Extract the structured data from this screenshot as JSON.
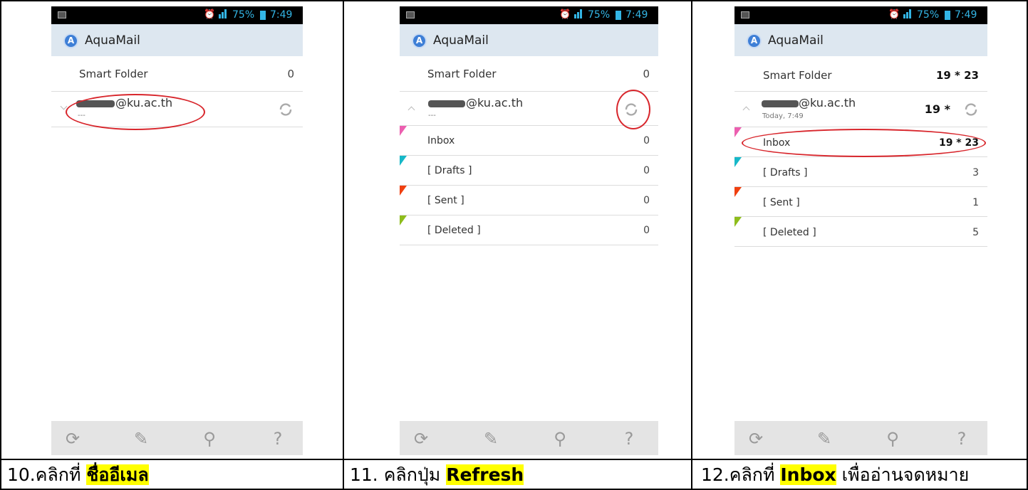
{
  "app": {
    "title": "AquaMail"
  },
  "status": {
    "battery": "75%",
    "time": "7:49"
  },
  "screens": [
    {
      "smart_folder": {
        "label": "Smart Folder",
        "count": "0"
      },
      "account": {
        "email": "@ku.ac.th",
        "sub": "---"
      }
    },
    {
      "smart_folder": {
        "label": "Smart Folder",
        "count": "0"
      },
      "account": {
        "email": "@ku.ac.th",
        "sub": "---"
      },
      "folders": [
        {
          "label": "Inbox",
          "count": "0",
          "color": "#ec5fb0"
        },
        {
          "label": "[ Drafts ]",
          "count": "0",
          "color": "#17b8c8"
        },
        {
          "label": "[ Sent ]",
          "count": "0",
          "color": "#f04010"
        },
        {
          "label": "[ Deleted ]",
          "count": "0",
          "color": "#8ebd1c"
        }
      ]
    },
    {
      "smart_folder": {
        "label": "Smart Folder",
        "count": "19 * 23"
      },
      "account": {
        "email": "@ku.ac.th",
        "sub": "Today, 7:49",
        "count": "19 *"
      },
      "folders": [
        {
          "label": "Inbox",
          "count": "19 * 23",
          "color": "#ec5fb0"
        },
        {
          "label": "[ Drafts ]",
          "count": "3",
          "color": "#17b8c8"
        },
        {
          "label": "[ Sent ]",
          "count": "1",
          "color": "#f04010"
        },
        {
          "label": "[ Deleted ]",
          "count": "5",
          "color": "#8ebd1c"
        }
      ]
    }
  ],
  "captions": [
    {
      "prefix": "10.คลิกที่ ",
      "highlight": "ชื่ออีเมล",
      "suffix": ""
    },
    {
      "prefix": "11. คลิกปุ่ม ",
      "highlight": "Refresh",
      "suffix": ""
    },
    {
      "prefix": "12.คลิกที่ ",
      "highlight": "Inbox",
      "suffix": " เพื่ออ่านจดหมาย"
    }
  ],
  "colors": {
    "status_text": "#33b5e5",
    "actionbar": "#dde7f0",
    "annotation": "#d8262c",
    "highlight": "#ffff00"
  },
  "icons": [
    "refresh-icon",
    "pencil-icon",
    "search-icon",
    "help-icon",
    "alarm-icon",
    "signal-icon",
    "battery-icon",
    "image-icon",
    "aquamail-logo-icon"
  ]
}
